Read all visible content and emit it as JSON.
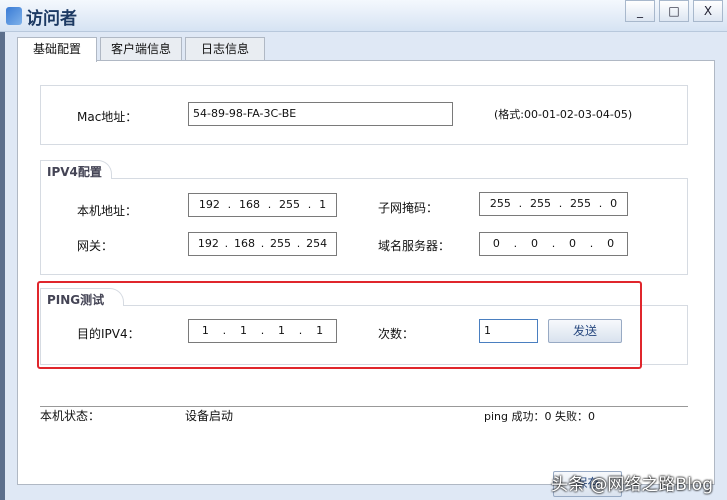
{
  "window": {
    "title": "访问者",
    "minimize": "_",
    "maximize": "□",
    "close": "X"
  },
  "tabs": [
    "基础配置",
    "客户端信息",
    "日志信息"
  ],
  "mac": {
    "label": "Mac地址：",
    "value": "54-89-98-FA-3C-BE",
    "hint": "(格式:00-01-02-03-04-05)"
  },
  "ipv4": {
    "section": "IPV4配置",
    "ip_label": "本机地址：",
    "ip": [
      "192",
      "168",
      "255",
      "1"
    ],
    "mask_label": "子网掩码：",
    "mask": [
      "255",
      "255",
      "255",
      "0"
    ],
    "gw_label": "网关：",
    "gw": [
      "192",
      "168",
      "255",
      "254"
    ],
    "dns_label": "域名服务器：",
    "dns": [
      "0",
      "0",
      "0",
      "0"
    ]
  },
  "ping": {
    "section": "PING测试",
    "dest_label": "目的IPV4：",
    "dest": [
      "1",
      "1",
      "1",
      "1"
    ],
    "count_label": "次数：",
    "count": "1",
    "send": "发送"
  },
  "status": {
    "label": "本机状态：",
    "value": "设备启动",
    "ping_result": "ping 成功：0 失败：0"
  },
  "save": "保存",
  "watermark": "头条 @网络之路Blog"
}
